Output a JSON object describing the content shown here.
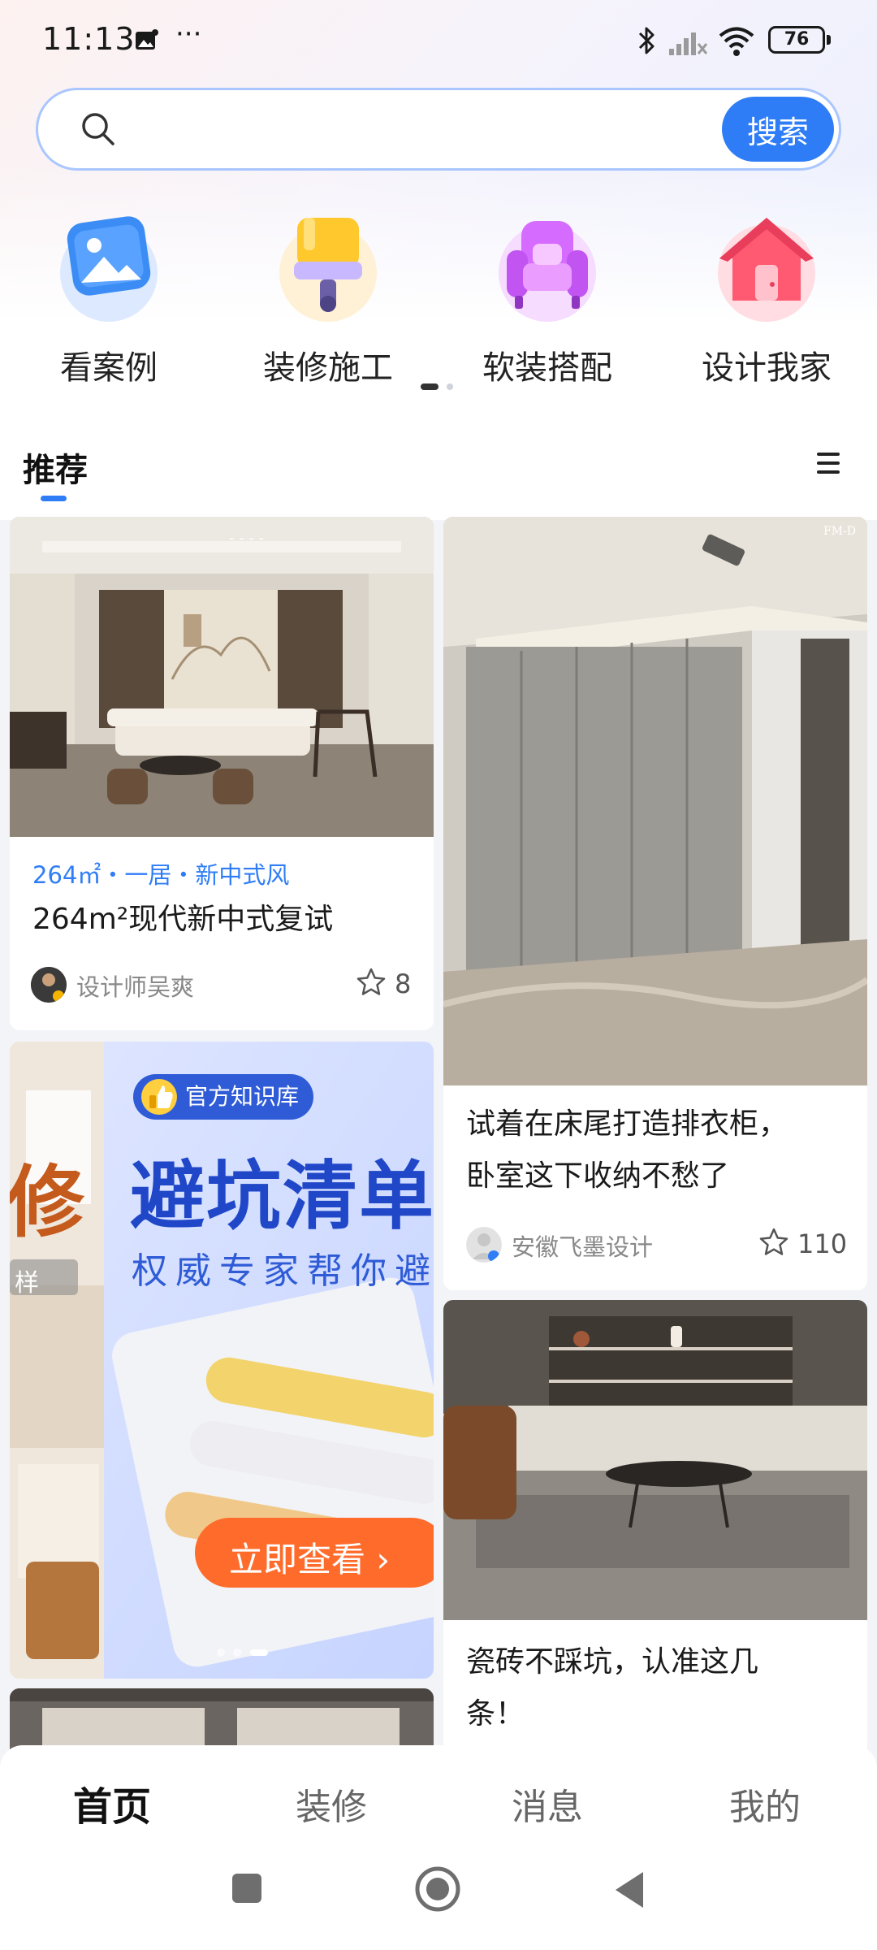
{
  "status_bar": {
    "time": "11:13",
    "more": "···",
    "battery": "76"
  },
  "search": {
    "placeholder": "",
    "value": "",
    "button_label": "搜索",
    "accent": "#2f7df6"
  },
  "categories": [
    {
      "label": "看案例",
      "icon": "picture-icon"
    },
    {
      "label": "装修施工",
      "icon": "paint-roller-icon"
    },
    {
      "label": "软装搭配",
      "icon": "armchair-icon"
    },
    {
      "label": "设计我家",
      "icon": "house-icon"
    }
  ],
  "carousel_pages": {
    "current": 1,
    "total": 2
  },
  "feed": {
    "tab_title": "推荐",
    "menu_icon": "list-menu-icon",
    "cards": [
      {
        "tag": "264㎡・一居・新中式风",
        "title": "264m²现代新中式复试",
        "author": "设计师吴爽",
        "favorites": "8"
      },
      {
        "title_line1": "试着在床尾打造排衣柜，",
        "title_line2": "卧室这下收纳不愁了",
        "author": "安徽飞墨设计",
        "favorites": "110"
      },
      {
        "ad_badge": "官方知识库",
        "ad_headline": "避坑清单",
        "ad_subline": "权威专家帮你避",
        "ad_button": "立即查看",
        "ad_side_char": "修",
        "ad_side_small": "样"
      },
      {
        "title_line1": "瓷砖不踩坑，认准这几",
        "title_line2": "条！"
      }
    ]
  },
  "bottom_nav": {
    "items": [
      "首页",
      "装修",
      "消息",
      "我的"
    ],
    "active_index": 0
  }
}
